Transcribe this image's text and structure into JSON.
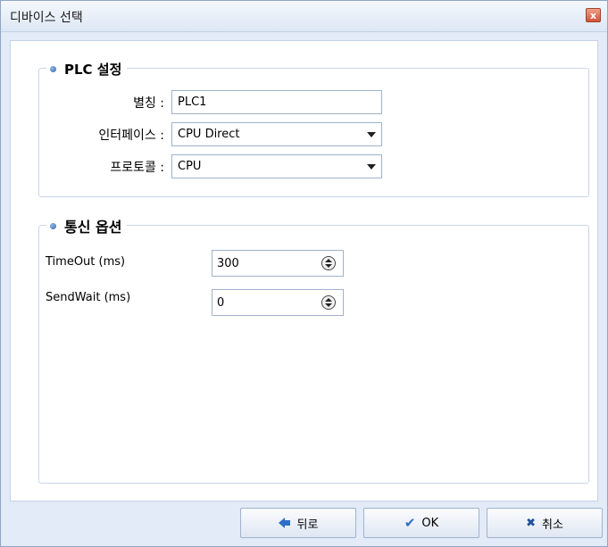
{
  "window": {
    "title": "디바이스 선택",
    "close_label": "x"
  },
  "plc_settings": {
    "legend": "PLC 설정",
    "alias_label": "별칭 :",
    "alias_value": "PLC1",
    "interface_label": "인터페이스 :",
    "interface_value": "CPU Direct",
    "protocol_label": "프로토콜 :",
    "protocol_value": "CPU"
  },
  "comm_options": {
    "legend": "통신 옵션",
    "timeout_label": "TimeOut (ms)",
    "timeout_value": "300",
    "sendwait_label": "SendWait (ms)",
    "sendwait_value": "0"
  },
  "footer": {
    "back_label": "뒤로",
    "ok_label": "OK",
    "cancel_label": "취소"
  },
  "icons": {
    "bullet": "bullet-dot-icon",
    "back": "arrow-left-icon",
    "ok": "checkmark-icon",
    "cancel": "x-icon",
    "dropdown": "chevron-down-icon",
    "spin": "spin-updown-icon"
  },
  "colors": {
    "accent": "#2f6fc6",
    "window_bg": "#e2ebf7",
    "border": "#9fb2cc"
  }
}
